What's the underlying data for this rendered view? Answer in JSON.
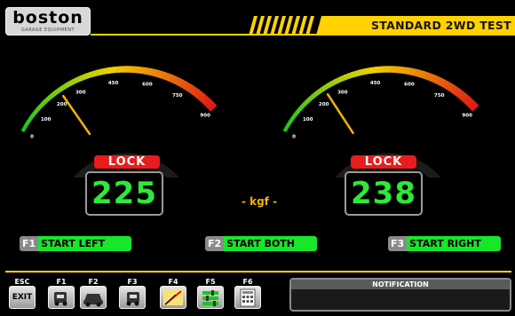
{
  "header": {
    "brand": "boston",
    "brand_sub": "GARAGE EQUIPMENT",
    "title": "STANDARD 2WD TEST",
    "accent": "#ffd200"
  },
  "gauges": {
    "scale_labels": [
      "0",
      "100",
      "200",
      "300",
      "450",
      "600",
      "750",
      "900"
    ],
    "left": {
      "status": "LOCK",
      "value": "225",
      "needle_value": 225
    },
    "right": {
      "status": "LOCK",
      "value": "238",
      "needle_value": 238
    },
    "unit": "- kgf -",
    "colors": {
      "low": "#18c81c",
      "mid": "#f0d000",
      "high": "#e01818",
      "readout": "#2fe83a",
      "lock": "#e81c1c"
    }
  },
  "function_buttons": [
    {
      "key": "F1",
      "label": "START LEFT"
    },
    {
      "key": "F2",
      "label": "START BOTH"
    },
    {
      "key": "F3",
      "label": "START RIGHT"
    }
  ],
  "toolbar": {
    "exit_key": "ESC",
    "exit_label": "EXIT",
    "keys": [
      {
        "key": "F1",
        "icon": "car-left-icon"
      },
      {
        "key": "F2",
        "icon": "car-front-icon"
      },
      {
        "key": "F3",
        "icon": "car-right-icon"
      },
      {
        "key": "F4",
        "icon": "percent-chart-icon"
      },
      {
        "key": "F5",
        "icon": "sliders-icon"
      },
      {
        "key": "F6",
        "icon": "calculator-icon"
      }
    ]
  },
  "notification": {
    "title": "NOTIFICATION",
    "text": ""
  }
}
